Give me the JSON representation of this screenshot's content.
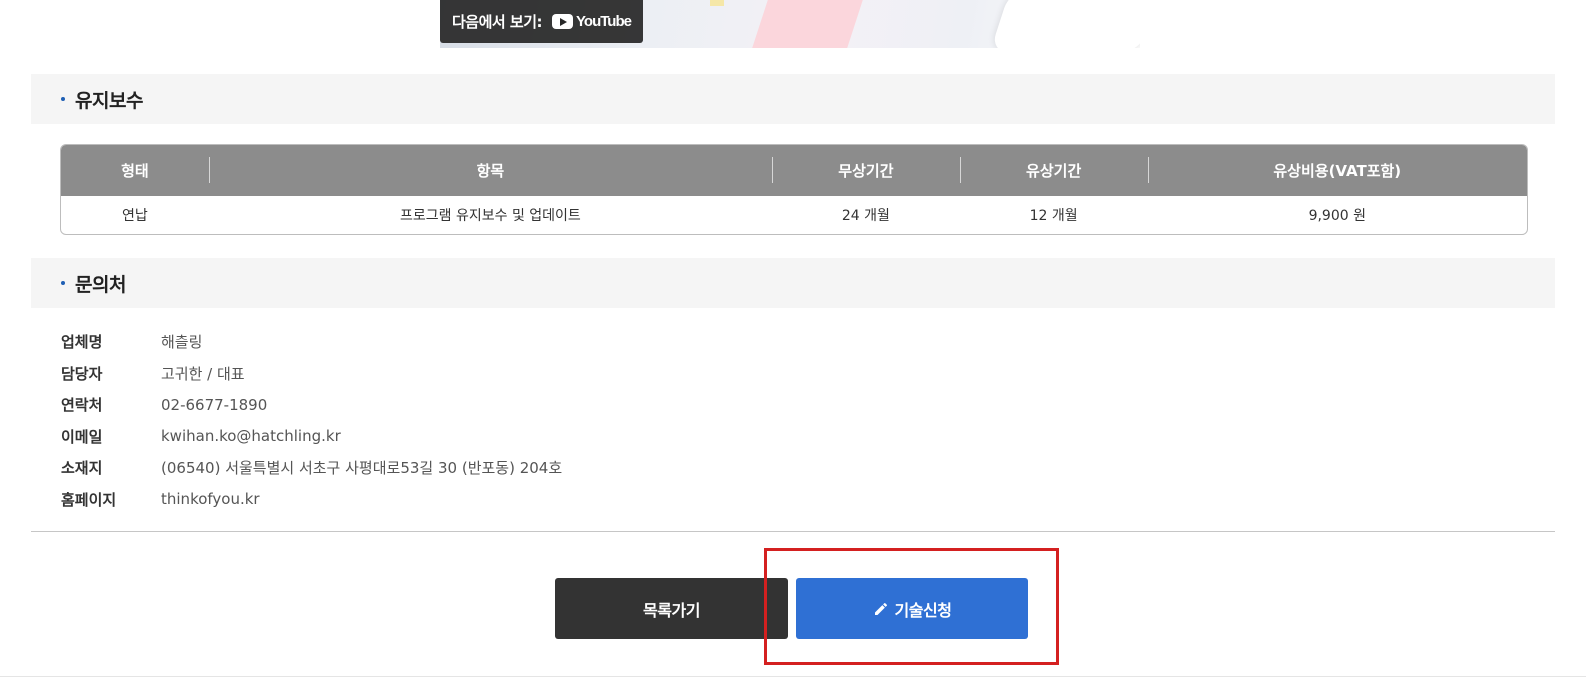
{
  "video": {
    "watch_on_label": "다음에서 보기:",
    "brand": "YouTube"
  },
  "maintenance": {
    "title": "유지보수",
    "table": {
      "headers": [
        "형태",
        "항목",
        "무상기간",
        "유상기간",
        "유상비용(VAT포함)"
      ],
      "rows": [
        [
          "연납",
          "프로그램 유지보수 및 업데이트",
          "24 개월",
          "12 개월",
          "9,900 원"
        ]
      ]
    }
  },
  "contact": {
    "title": "문의처",
    "rows": [
      {
        "label": "업체명",
        "value": "해츨링"
      },
      {
        "label": "담당자",
        "value": "고귀한 / 대표"
      },
      {
        "label": "연락처",
        "value": "02-6677-1890"
      },
      {
        "label": "이메일",
        "value": "kwihan.ko@hatchling.kr"
      },
      {
        "label": "소재지",
        "value": "(06540) 서울특별시 서초구 사평대로53길 30 (반포동) 204호"
      },
      {
        "label": "홈페이지",
        "value": "thinkofyou.kr"
      }
    ]
  },
  "actions": {
    "list_label": "목록가기",
    "apply_label": "기술신청"
  },
  "colors": {
    "accent_blue": "#2f70d4",
    "dark_button": "#333333",
    "table_header": "#8c8c8c",
    "highlight_red": "#d42020"
  }
}
